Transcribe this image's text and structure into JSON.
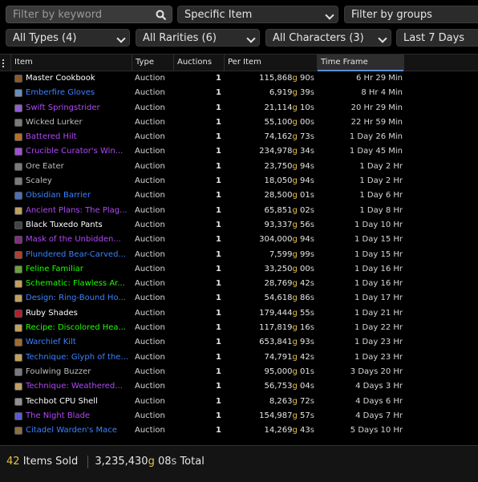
{
  "filters": {
    "search_placeholder": "Filter by keyword",
    "mode": "Specific Item",
    "groups": "Filter by groups",
    "types": "All Types (4)",
    "rarities": "All Rarities (6)",
    "characters": "All Characters (3)",
    "timeframe": "Last 7 Days"
  },
  "columns": {
    "item": "Item",
    "type": "Type",
    "auctions": "Auctions",
    "per_item": "Per Item",
    "time_frame": "Time Frame"
  },
  "colors": {
    "common": "#ffffff",
    "poor": "#bdbdbd",
    "uncommon": "#1eff00",
    "rare": "#3b82ff",
    "epic": "#b048f8",
    "gold": "#e6c34a"
  },
  "rows": [
    {
      "name": "Master Cookbook",
      "rarity": "common",
      "type": "Auction",
      "auctions": "1",
      "gold": "115,868",
      "silver": "90",
      "time": "6 Hr 29 Min",
      "icon": "book-icon"
    },
    {
      "name": "Emberfire Gloves",
      "rarity": "rare",
      "type": "Auction",
      "auctions": "1",
      "gold": "6,919",
      "silver": "39",
      "time": "8 Hr 4 Min",
      "icon": "gloves-icon"
    },
    {
      "name": "Swift Springstrider",
      "rarity": "epic",
      "type": "Auction",
      "auctions": "1",
      "gold": "21,114",
      "silver": "10",
      "time": "20 Hr 29 Min",
      "icon": "mount-icon"
    },
    {
      "name": "Wicked Lurker",
      "rarity": "poor",
      "type": "Auction",
      "auctions": "1",
      "gold": "55,100",
      "silver": "00",
      "time": "22 Hr 59 Min",
      "icon": "pet-icon"
    },
    {
      "name": "Battered Hilt",
      "rarity": "epic",
      "type": "Auction",
      "auctions": "1",
      "gold": "74,162",
      "silver": "73",
      "time": "1 Day 26 Min",
      "icon": "hilt-icon"
    },
    {
      "name": "Crucible Curator's Win...",
      "rarity": "epic",
      "type": "Auction",
      "auctions": "1",
      "gold": "234,978",
      "silver": "34",
      "time": "1 Day 45 Min",
      "icon": "wings-icon"
    },
    {
      "name": "Ore Eater",
      "rarity": "poor",
      "type": "Auction",
      "auctions": "1",
      "gold": "23,750",
      "silver": "94",
      "time": "1 Day 2 Hr",
      "icon": "pet-icon"
    },
    {
      "name": "Scaley",
      "rarity": "poor",
      "type": "Auction",
      "auctions": "1",
      "gold": "18,050",
      "silver": "94",
      "time": "1 Day 2 Hr",
      "icon": "pet-icon"
    },
    {
      "name": "Obsidian Barrier",
      "rarity": "rare",
      "type": "Auction",
      "auctions": "1",
      "gold": "28,500",
      "silver": "01",
      "time": "1 Day 6 Hr",
      "icon": "shield-icon"
    },
    {
      "name": "Ancient Plans: The Plag...",
      "rarity": "epic",
      "type": "Auction",
      "auctions": "1",
      "gold": "65,851",
      "silver": "02",
      "time": "1 Day 8 Hr",
      "icon": "scroll-icon"
    },
    {
      "name": "Black Tuxedo Pants",
      "rarity": "common",
      "type": "Auction",
      "auctions": "1",
      "gold": "93,337",
      "silver": "56",
      "time": "1 Day 10 Hr",
      "icon": "pants-icon"
    },
    {
      "name": "Mask of the Unbidden...",
      "rarity": "epic",
      "type": "Auction",
      "auctions": "1",
      "gold": "304,000",
      "silver": "94",
      "time": "1 Day 15 Hr",
      "icon": "mask-icon"
    },
    {
      "name": "Plundered Bear-Carved...",
      "rarity": "rare",
      "type": "Auction",
      "auctions": "1",
      "gold": "7,599",
      "silver": "99",
      "time": "1 Day 15 Hr",
      "icon": "chest-icon"
    },
    {
      "name": "Feline Familiar",
      "rarity": "uncommon",
      "type": "Auction",
      "auctions": "1",
      "gold": "33,250",
      "silver": "00",
      "time": "1 Day 16 Hr",
      "icon": "cat-icon"
    },
    {
      "name": "Schematic: Flawless Ar...",
      "rarity": "uncommon",
      "type": "Auction",
      "auctions": "1",
      "gold": "28,769",
      "silver": "42",
      "time": "1 Day 16 Hr",
      "icon": "scroll-icon"
    },
    {
      "name": "Design: Ring-Bound Ho...",
      "rarity": "rare",
      "type": "Auction",
      "auctions": "1",
      "gold": "54,618",
      "silver": "86",
      "time": "1 Day 17 Hr",
      "icon": "scroll-icon"
    },
    {
      "name": "Ruby Shades",
      "rarity": "common",
      "type": "Auction",
      "auctions": "1",
      "gold": "179,444",
      "silver": "55",
      "time": "1 Day 21 Hr",
      "icon": "glasses-icon"
    },
    {
      "name": "Recipe: Discolored Hea...",
      "rarity": "uncommon",
      "type": "Auction",
      "auctions": "1",
      "gold": "117,819",
      "silver": "16",
      "time": "1 Day 22 Hr",
      "icon": "scroll-icon"
    },
    {
      "name": "Warchief Kilt",
      "rarity": "rare",
      "type": "Auction",
      "auctions": "1",
      "gold": "653,841",
      "silver": "93",
      "time": "1 Day 23 Hr",
      "icon": "kilt-icon"
    },
    {
      "name": "Technique: Glyph of the...",
      "rarity": "rare",
      "type": "Auction",
      "auctions": "1",
      "gold": "74,791",
      "silver": "42",
      "time": "1 Day 23 Hr",
      "icon": "scroll-icon"
    },
    {
      "name": "Foulwing Buzzer",
      "rarity": "poor",
      "type": "Auction",
      "auctions": "1",
      "gold": "95,000",
      "silver": "01",
      "time": "3 Days 20 Hr",
      "icon": "pet-icon"
    },
    {
      "name": "Technique: Weathered...",
      "rarity": "epic",
      "type": "Auction",
      "auctions": "1",
      "gold": "56,753",
      "silver": "04",
      "time": "4 Days 3 Hr",
      "icon": "scroll-icon"
    },
    {
      "name": "Techbot CPU Shell",
      "rarity": "common",
      "type": "Auction",
      "auctions": "1",
      "gold": "8,263",
      "silver": "72",
      "time": "4 Days 6 Hr",
      "icon": "gear-icon"
    },
    {
      "name": "The Night Blade",
      "rarity": "epic",
      "type": "Auction",
      "auctions": "1",
      "gold": "154,987",
      "silver": "57",
      "time": "4 Days 7 Hr",
      "icon": "sword-icon"
    },
    {
      "name": "Citadel Warden's Mace",
      "rarity": "rare",
      "type": "Auction",
      "auctions": "1",
      "gold": "14,269",
      "silver": "43",
      "time": "5 Days 10 Hr",
      "icon": "mace-icon"
    }
  ],
  "footer": {
    "count": "42",
    "count_label": "Items Sold",
    "total_gold": "3,235,430",
    "total_silver": "08",
    "total_label": "Total"
  }
}
